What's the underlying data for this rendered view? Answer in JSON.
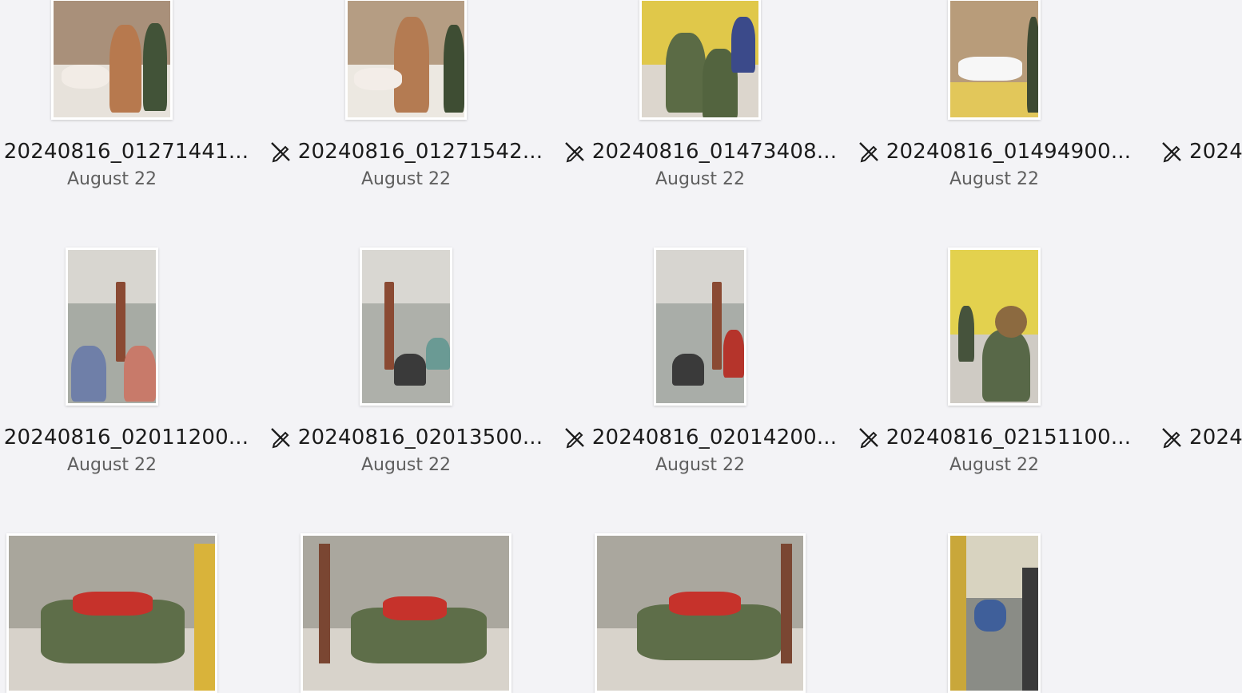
{
  "gallery": {
    "rows": [
      {
        "items": [
          {
            "name": "20240816_01271441...",
            "date": "August 22"
          },
          {
            "name": "20240816_01271542...",
            "date": "August 22"
          },
          {
            "name": "20240816_01473408...",
            "date": "August 22"
          },
          {
            "name": "20240816_01494900...",
            "date": "August 22"
          }
        ],
        "partial_name": "2024("
      },
      {
        "items": [
          {
            "name": "20240816_02011200...",
            "date": "August 22"
          },
          {
            "name": "20240816_02013500...",
            "date": "August 22"
          },
          {
            "name": "20240816_02014200...",
            "date": "August 22"
          },
          {
            "name": "20240816_02151100...",
            "date": "August 22"
          }
        ],
        "partial_name": "2024("
      }
    ]
  },
  "icons": {
    "file_status": "no-edit-pencil-icon"
  },
  "colors": {
    "background": "#f3f3f6",
    "text_primary": "#1b1b1b",
    "text_secondary": "#5f5f5f"
  }
}
